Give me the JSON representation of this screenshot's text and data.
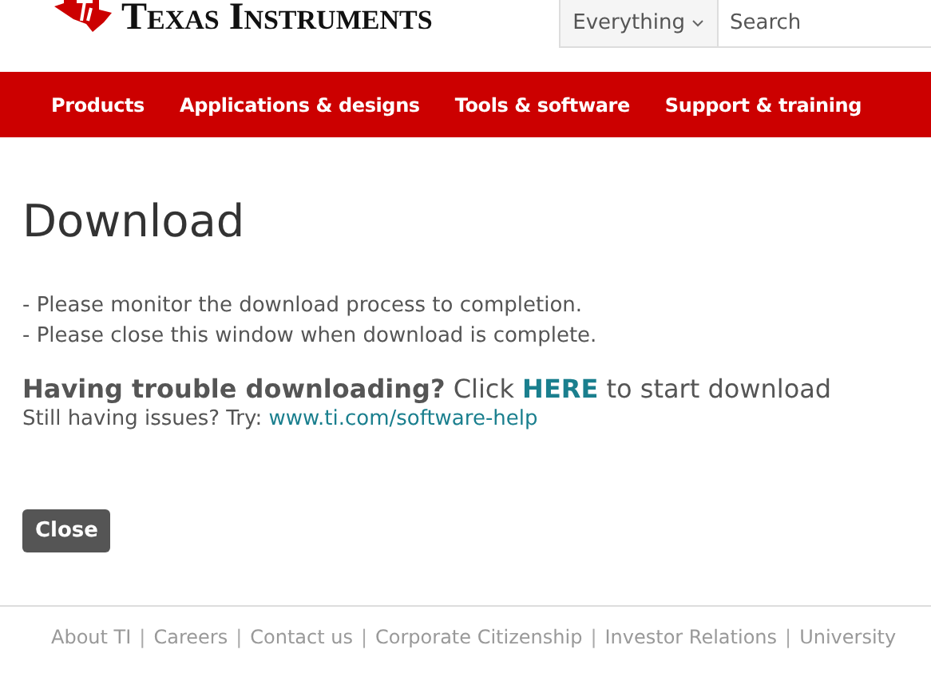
{
  "logo": {
    "text": "Texas Instruments"
  },
  "search": {
    "scope": "Everything",
    "placeholder": "Search"
  },
  "nav": [
    "Products",
    "Applications & designs",
    "Tools & software",
    "Support & training"
  ],
  "title": "Download",
  "instructions": [
    "- Please monitor the download process to completion.",
    "- Please close this window when download is complete."
  ],
  "trouble": {
    "question": "Having trouble downloading?",
    "before": "Click",
    "link": "HERE",
    "after": "to start download"
  },
  "help": {
    "text": "Still having issues? Try:",
    "link": "www.ti.com/software-help"
  },
  "close_button": "Close",
  "footer": [
    {
      "kind": "link",
      "text": "About TI"
    },
    {
      "kind": "sep",
      "text": "|"
    },
    {
      "kind": "link",
      "text": "Careers"
    },
    {
      "kind": "sep",
      "text": "|"
    },
    {
      "kind": "link",
      "text": "Contact us"
    },
    {
      "kind": "sep",
      "text": "|"
    },
    {
      "kind": "link",
      "text": "Corporate Citizenship"
    },
    {
      "kind": "sep",
      "text": "|"
    },
    {
      "kind": "link",
      "text": "Investor Relations"
    },
    {
      "kind": "sep",
      "text": "|"
    },
    {
      "kind": "link",
      "text": "University"
    }
  ]
}
